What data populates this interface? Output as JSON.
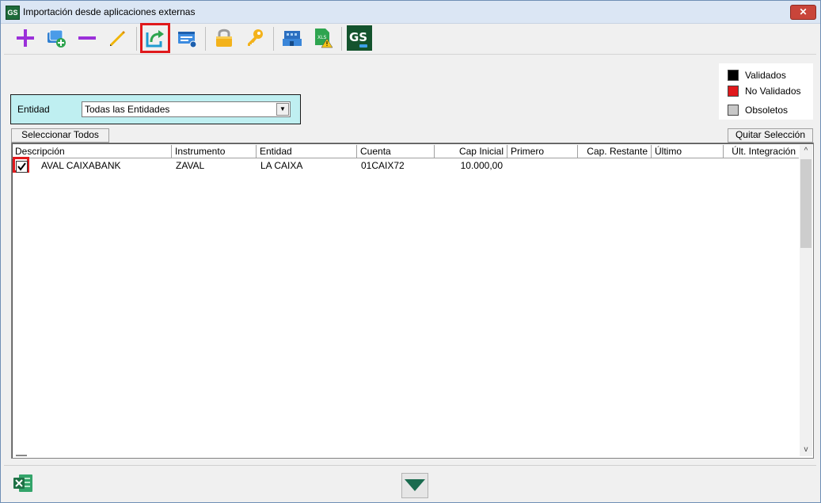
{
  "window": {
    "app_icon": "GS",
    "title": "Importación desde aplicaciones externas",
    "close_glyph": "✕"
  },
  "toolbar": {
    "buttons": [
      {
        "icon": "add-icon"
      },
      {
        "icon": "add-documents-icon"
      },
      {
        "icon": "remove-icon"
      },
      {
        "icon": "edit-pencil-icon"
      },
      {
        "icon": "import-export-icon",
        "highlighted": true
      },
      {
        "icon": "card-view-icon"
      },
      {
        "icon": "lock-icon"
      },
      {
        "icon": "key-icon"
      },
      {
        "icon": "building-icon"
      },
      {
        "icon": "xls-warning-icon"
      },
      {
        "icon": "gs-logo-icon"
      }
    ],
    "xls_label": "XLS",
    "gs_label": "GS"
  },
  "legend": {
    "items": [
      {
        "label": "Validados",
        "color": "#000000"
      },
      {
        "label": "No Validados",
        "color": "#e0191c"
      },
      {
        "label": "Obsoletos",
        "color": "#c8c8c8"
      }
    ]
  },
  "filter": {
    "label": "Entidad",
    "value": "Todas las Entidades"
  },
  "actions": {
    "select_all": "Seleccionar Todos",
    "clear_selection": "Quitar Selección"
  },
  "grid": {
    "columns": [
      "Descripción",
      "Instrumento",
      "Entidad",
      "Cuenta",
      "Cap Inicial",
      "Primero",
      "Cap. Restante",
      "Último",
      "Últ. Integración"
    ],
    "rows": [
      {
        "checked": true,
        "descripcion": "AVAL CAIXABANK",
        "instrumento": "ZAVAL",
        "entidad": "LA CAIXA",
        "cuenta": "01CAIX72",
        "cap_inicial": "10.000,00",
        "primero": "",
        "cap_restante": "",
        "ultimo": "",
        "ult_integracion": ""
      }
    ]
  },
  "colors": {
    "accent": "#1e6b3a",
    "highlight": "#e0191c",
    "filter_bg": "#bfeff1"
  }
}
